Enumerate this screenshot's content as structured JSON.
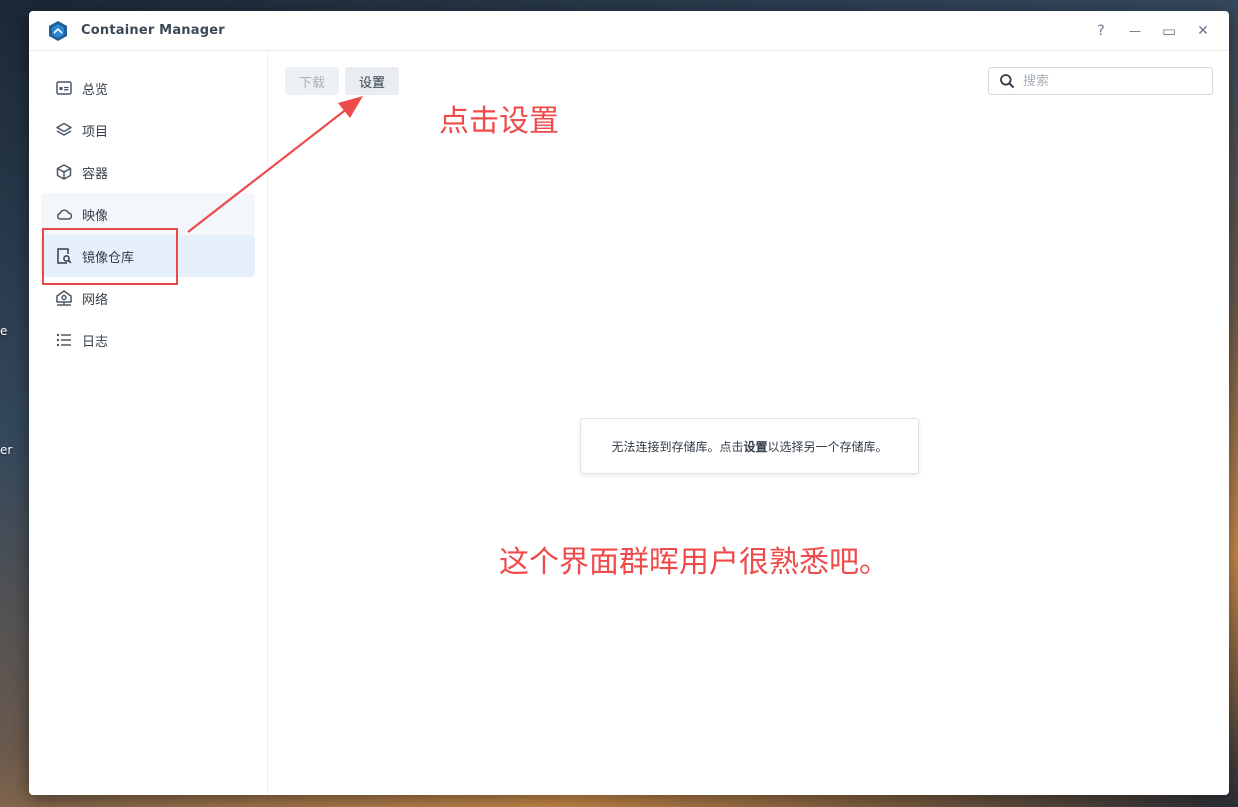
{
  "window": {
    "title": "Container Manager",
    "controls": [
      "?",
      "—",
      "▭",
      "✕"
    ]
  },
  "desktop": {
    "fragment_1": "e",
    "fragment_2": "er"
  },
  "sidebar": {
    "items": [
      {
        "label": "总览",
        "icon": "overview-icon"
      },
      {
        "label": "项目",
        "icon": "layers-icon"
      },
      {
        "label": "容器",
        "icon": "cube-icon"
      },
      {
        "label": "映像",
        "icon": "cloud-icon"
      },
      {
        "label": "镜像仓库",
        "icon": "registry-search-icon",
        "active": true
      },
      {
        "label": "网络",
        "icon": "network-icon"
      },
      {
        "label": "日志",
        "icon": "list-icon"
      }
    ]
  },
  "toolbar": {
    "download_label": "下载",
    "settings_label": "设置"
  },
  "search": {
    "placeholder": "搜索"
  },
  "message": {
    "before": "无法连接到存储库。点击",
    "bold": "设置",
    "after": "以选择另一个存储库。"
  },
  "annotations": {
    "click_settings": "点击设置",
    "caption": "这个界面群晖用户很熟悉吧。"
  },
  "colors": {
    "accent": "#0b6fce",
    "annotation": "#f04b4b",
    "active_bg": "#e6f0fb"
  }
}
